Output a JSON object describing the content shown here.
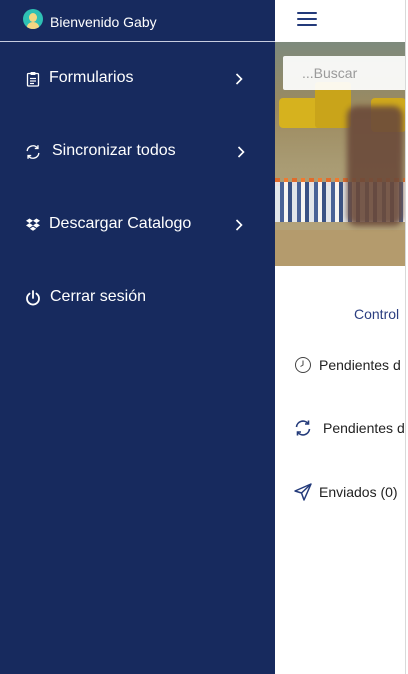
{
  "drawer": {
    "greeting": "Bienvenido Gaby",
    "items": [
      {
        "label": "Formularios",
        "icon": "clipboard-icon"
      },
      {
        "label": "Sincronizar todos",
        "icon": "sync-icon"
      },
      {
        "label": "Descargar Catalogo",
        "icon": "dropbox-icon"
      },
      {
        "label": "Cerrar sesión",
        "icon": "power-icon"
      }
    ],
    "colors": {
      "background": "#172a5e",
      "text": "#ffffff"
    }
  },
  "main": {
    "search": {
      "placeholder": "...Buscar"
    },
    "section_label": "Control",
    "rows": [
      {
        "label": "Pendientes d",
        "icon": "clock-icon"
      },
      {
        "label": "Pendientes d",
        "icon": "sync-icon"
      },
      {
        "label": "Enviados (0)",
        "icon": "send-icon"
      }
    ],
    "colors": {
      "accent": "#233a7a"
    }
  }
}
